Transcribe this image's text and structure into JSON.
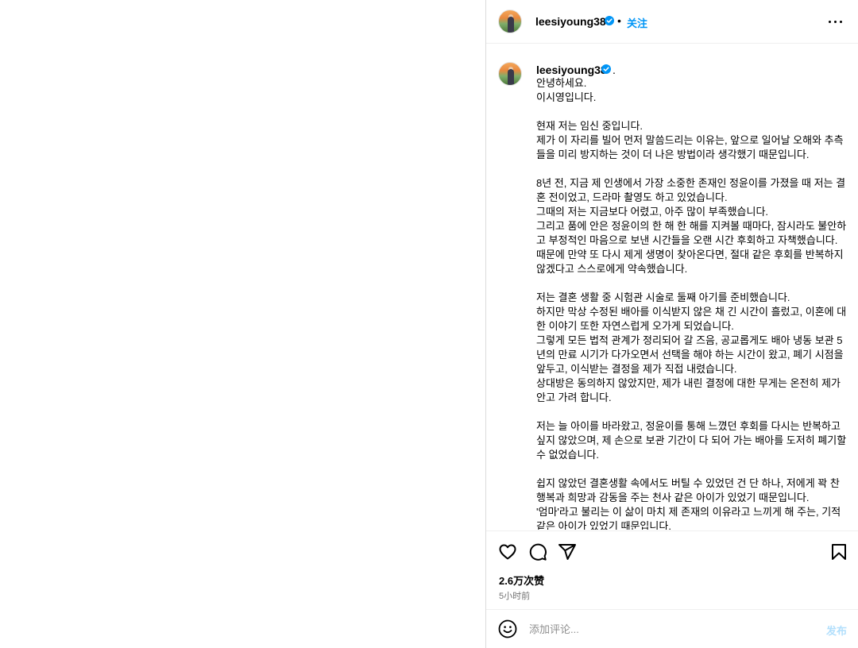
{
  "post": {
    "username": "leesiyoung38",
    "dot_separator": "•",
    "follow_label": "关注"
  },
  "caption": {
    "username": "leesiyoung38",
    "trailing_period": ".",
    "lines": [
      "안녕하세요.",
      "이시영입니다.",
      "",
      "현재 저는 임신 중입니다.",
      "제가 이 자리를 빌어 먼저 말씀드리는 이유는, 앞으로 일어날 오해와 추측",
      "들을 미리 방지하는 것이 더 나은 방법이라 생각했기 때문입니다.",
      "",
      "8년 전, 지금 제 인생에서 가장 소중한 존재인 정윤이를 가졌을 때 저는 결",
      "혼 전이었고, 드라마 촬영도 하고 있었습니다.",
      "그때의 저는 지금보다 어렸고, 아주 많이 부족했습니다.",
      "그리고 품에 안은 정윤이의 한 해 한 해를 지켜볼 때마다, 잠시라도 불안하",
      "고 부정적인 마음으로 보낸 시간들을 오랜 시간 후회하고 자책했습니다.",
      "때문에 만약 또 다시 제게 생명이 찾아온다면, 절대 같은 후회를 반복하지",
      "않겠다고 스스로에게 약속했습니다.",
      "",
      "저는 결혼 생활 중 시험관 시술로 둘째 아기를 준비했습니다.",
      "하지만 막상 수정된 배아를 이식받지 않은 채 긴 시간이 흘렀고, 이혼에 대",
      "한 이야기 또한 자연스럽게 오가게 되었습니다.",
      "그렇게 모든 법적 관계가 정리되어 갈 즈음, 공교롭게도 배아 냉동 보관 5",
      "년의 만료 시기가 다가오면서 선택을 해야 하는 시간이 왔고, 폐기 시점을",
      "앞두고, 이식받는 결정을 제가 직접 내렸습니다.",
      "상대방은 동의하지 않았지만, 제가 내린 결정에 대한 무게는 온전히 제가",
      "안고 가려 합니다.",
      "",
      "저는 늘 아이를 바라왔고, 정윤이를 통해 느꼈던 후회를 다시는 반복하고",
      "싶지 않았으며, 제 손으로 보관 기간이 다 되어 가는 배아를 도저히 폐기할",
      "수 없었습니다.",
      "",
      "쉽지 않았던 결혼생활 속에서도 버틸 수 있었던 건 단 하나, 저에게 꽉 찬",
      "행복과 희망과 감동을 주는 천사 같은 아이가 있었기 때문입니다.",
      "'엄마'라고 불리는 이 삶이 마치 제 존재의 이유라고 느끼게 해 주는, 기적",
      "같은 아이가 있었기 때문입니다."
    ]
  },
  "actions": {
    "like_icon": "heart-icon",
    "comment_icon": "comment-icon",
    "share_icon": "paper-plane-icon",
    "save_icon": "bookmark-icon"
  },
  "stats": {
    "likes": "2.6万次赞",
    "time_ago": "5小时前"
  },
  "comment": {
    "placeholder": "添加评论...",
    "post_label": "发布"
  },
  "colors": {
    "accent": "#0095f6",
    "verified": "#0095f6",
    "post_disabled": "#b2dffc",
    "muted": "#737373"
  }
}
